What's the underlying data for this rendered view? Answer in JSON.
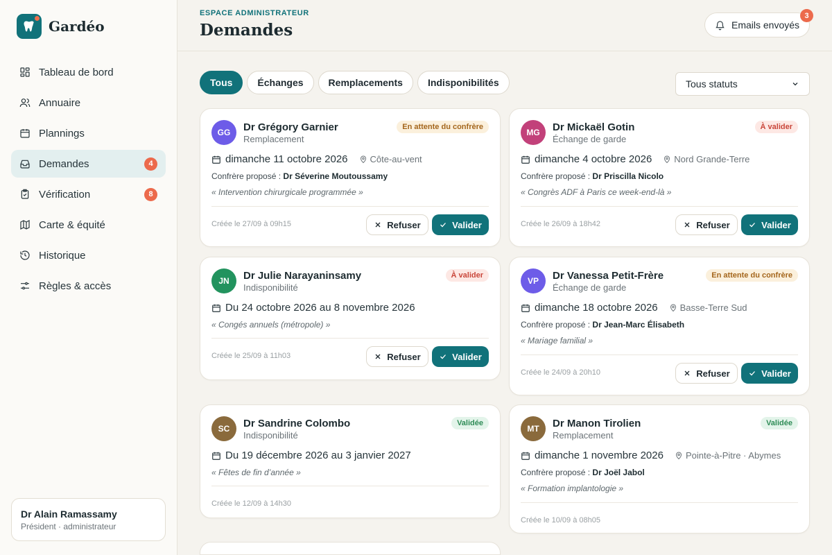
{
  "app": {
    "name": "Gardéo",
    "colors": {
      "accent": "#11727a",
      "badge": "#ec6a4c"
    }
  },
  "sidebar": {
    "items": [
      {
        "label": "Tableau de bord",
        "icon": "dashboard-icon"
      },
      {
        "label": "Annuaire",
        "icon": "users-icon"
      },
      {
        "label": "Plannings",
        "icon": "calendar-icon"
      },
      {
        "label": "Demandes",
        "icon": "inbox-icon",
        "badge": "4",
        "active": true
      },
      {
        "label": "Vérification",
        "icon": "clipboard-check-icon",
        "badge": "8"
      },
      {
        "label": "Carte & équité",
        "icon": "map-icon"
      },
      {
        "label": "Historique",
        "icon": "history-icon"
      },
      {
        "label": "Règles & accès",
        "icon": "settings-sliders-icon"
      }
    ],
    "profile": {
      "name": "Dr Alain Ramassamy",
      "role": "Président · administrateur"
    }
  },
  "header": {
    "eyebrow": "ESPACE ADMINISTRATEUR",
    "title": "Demandes",
    "emails_label": "Emails envoyés",
    "emails_badge": "3"
  },
  "filters": {
    "tabs": [
      "Tous",
      "Échanges",
      "Remplacements",
      "Indisponibilités"
    ],
    "active": 0,
    "status_select": "Tous statuts"
  },
  "labels": {
    "proposed": "Confrère proposé :",
    "refuse": "Refuser",
    "validate": "Valider"
  },
  "cards": [
    {
      "initials": "GG",
      "avatar_color": "#6d5ce8",
      "name": "Dr Grégory Garnier",
      "type": "Remplacement",
      "status": "En attente du confrère",
      "status_kind": "wait",
      "date": "dimanche 11 octobre 2026",
      "location": "Côte-au-vent",
      "proposed": "Dr Séverine Moutoussamy",
      "note": "« Intervention chirurgicale programmée »",
      "created": "Créée le 27/09 à 09h15",
      "actions": true
    },
    {
      "initials": "MG",
      "avatar_color": "#c2417a",
      "name": "Dr Mickaël Gotin",
      "type": "Échange de garde",
      "status": "À valider",
      "status_kind": "valid",
      "date": "dimanche 4 octobre 2026",
      "location": "Nord Grande-Terre",
      "proposed": "Dr Priscilla Nicolo",
      "note": "« Congrès ADF à Paris ce week-end-là »",
      "created": "Créée le 26/09 à 18h42",
      "actions": true
    },
    {
      "initials": "JN",
      "avatar_color": "#22935e",
      "name": "Dr Julie Narayaninsamy",
      "type": "Indisponibilité",
      "status": "À valider",
      "status_kind": "valid",
      "date": "Du 24 octobre 2026 au 8 novembre 2026",
      "location": "",
      "proposed": "",
      "note": "« Congés annuels (métropole) »",
      "created": "Créée le 25/09 à 11h03",
      "actions": true
    },
    {
      "initials": "VP",
      "avatar_color": "#6d5ce8",
      "name": "Dr Vanessa Petit-Frère",
      "type": "Échange de garde",
      "status": "En attente du confrère",
      "status_kind": "wait",
      "date": "dimanche 18 octobre 2026",
      "location": "Basse-Terre Sud",
      "proposed": "Dr Jean-Marc Élisabeth",
      "note": "« Mariage familial »",
      "created": "Créée le 24/09 à 20h10",
      "actions": true
    },
    {
      "initials": "SC",
      "avatar_color": "#8a6a3c",
      "name": "Dr Sandrine Colombo",
      "type": "Indisponibilité",
      "status": "Validée",
      "status_kind": "done",
      "date": "Du 19 décembre 2026 au 3 janvier 2027",
      "location": "",
      "proposed": "",
      "note": "« Fêtes de fin d’année »",
      "created": "Créée le 12/09 à 14h30",
      "actions": false
    },
    {
      "initials": "MT",
      "avatar_color": "#8a6a3c",
      "name": "Dr Manon Tirolien",
      "type": "Remplacement",
      "status": "Validée",
      "status_kind": "done",
      "date": "dimanche 1 novembre 2026",
      "location": "Pointe-à-Pitre · Abymes",
      "proposed": "Dr Joël Jabol",
      "note": "« Formation implantologie »",
      "created": "Créée le 10/09 à 08h05",
      "actions": false
    }
  ]
}
